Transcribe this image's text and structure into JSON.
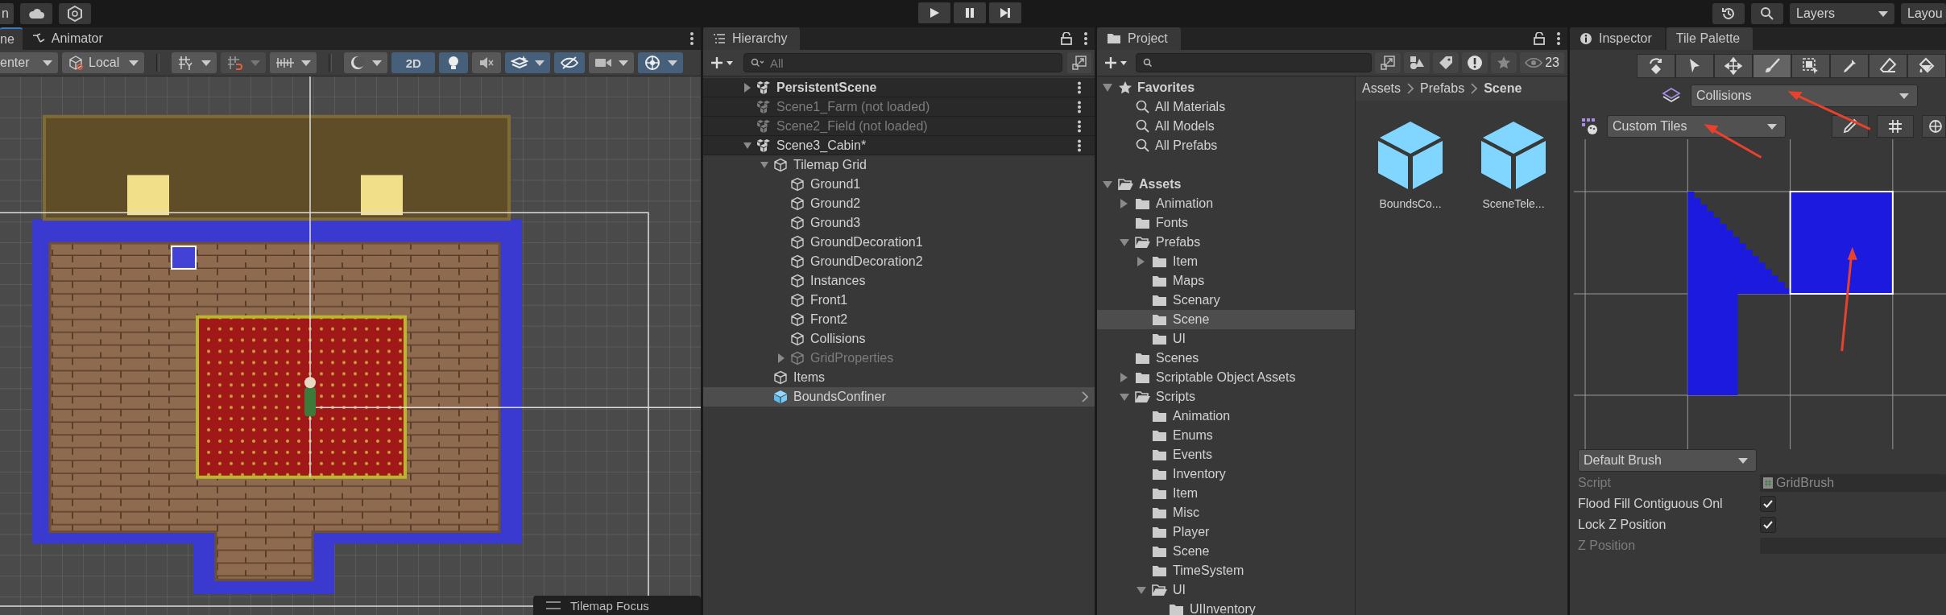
{
  "top_bar": {
    "account_label": "n",
    "play_controls": [
      {
        "kind": "play"
      },
      {
        "kind": "pause"
      },
      {
        "kind": "step"
      }
    ],
    "layers": "Layers",
    "layout": "Layou"
  },
  "scene_panel": {
    "tabs": [
      {
        "label": "ne",
        "kind": "scene",
        "selected": true
      },
      {
        "label": "Animator",
        "kind": "animator",
        "selected": false
      }
    ],
    "pivot": "enter",
    "space": "Local",
    "view_2d": {
      "label": "2D",
      "on": true
    },
    "toggles": [
      {
        "kind": "lighting",
        "on": true
      },
      {
        "kind": "audio",
        "on": false
      },
      {
        "kind": "effects",
        "on": true
      },
      {
        "kind": "visibility",
        "on": true
      },
      {
        "kind": "camera",
        "on": false
      },
      {
        "kind": "gizmos",
        "on": true
      }
    ],
    "overlay": "Tilemap Focus"
  },
  "hierarchy": {
    "title": "Hierarchy",
    "search_placeholder": "All",
    "scenes": [
      {
        "name": "PersistentScene",
        "active": true,
        "loaded": true,
        "expanded": false
      },
      {
        "name": "Scene1_Farm (not loaded)",
        "active": false,
        "loaded": false
      },
      {
        "name": "Scene2_Field (not loaded)",
        "active": false,
        "loaded": false
      },
      {
        "name": "Scene3_Cabin*",
        "active": false,
        "loaded": true,
        "expanded": true,
        "children": [
          {
            "name": "Tilemap Grid",
            "kind": "object",
            "selected": false,
            "disabled": false,
            "expanded": true,
            "children": [
              {
                "name": "Ground1",
                "kind": "object",
                "selected": false,
                "disabled": false
              },
              {
                "name": "Ground2",
                "kind": "object",
                "selected": false,
                "disabled": false
              },
              {
                "name": "Ground3",
                "kind": "object",
                "selected": false,
                "disabled": false
              },
              {
                "name": "GroundDecoration1",
                "kind": "object",
                "selected": false,
                "disabled": false
              },
              {
                "name": "GroundDecoration2",
                "kind": "object",
                "selected": false,
                "disabled": false
              },
              {
                "name": "Instances",
                "kind": "object",
                "selected": false,
                "disabled": false
              },
              {
                "name": "Front1",
                "kind": "object",
                "selected": false,
                "disabled": false
              },
              {
                "name": "Front2",
                "kind": "object",
                "selected": false,
                "disabled": false
              },
              {
                "name": "Collisions",
                "kind": "object",
                "selected": false,
                "disabled": false
              },
              {
                "name": "GridProperties",
                "kind": "object",
                "selected": false,
                "disabled": true,
                "expanded": false
              }
            ]
          },
          {
            "name": "Items",
            "kind": "object",
            "selected": false,
            "disabled": false
          },
          {
            "name": "BoundsConfiner",
            "kind": "prefab",
            "selected": true,
            "disabled": false
          }
        ]
      }
    ]
  },
  "project": {
    "title": "Project",
    "hidden_count": "23",
    "favorites": {
      "label": "Favorites",
      "expanded": true,
      "items": [
        {
          "name": "All Materials",
          "selected": false
        },
        {
          "name": "All Models",
          "selected": false
        },
        {
          "name": "All Prefabs",
          "selected": false
        }
      ]
    },
    "tree": [
      {
        "name": "Assets",
        "selected": false,
        "expanded": true,
        "children": [
          {
            "name": "Animation",
            "selected": false,
            "expanded": false
          },
          {
            "name": "Fonts",
            "selected": false
          },
          {
            "name": "Prefabs",
            "selected": false,
            "expanded": true,
            "children": [
              {
                "name": "Item",
                "selected": false,
                "expanded": false
              },
              {
                "name": "Maps",
                "selected": false
              },
              {
                "name": "Scenary",
                "selected": false
              },
              {
                "name": "Scene",
                "selected": true
              },
              {
                "name": "UI",
                "selected": false
              }
            ]
          },
          {
            "name": "Scenes",
            "selected": false
          },
          {
            "name": "Scriptable Object Assets",
            "selected": false,
            "expanded": false
          },
          {
            "name": "Scripts",
            "selected": false,
            "expanded": true,
            "children": [
              {
                "name": "Animation",
                "selected": false
              },
              {
                "name": "Enums",
                "selected": false
              },
              {
                "name": "Events",
                "selected": false
              },
              {
                "name": "Inventory",
                "selected": false
              },
              {
                "name": "Item",
                "selected": false
              },
              {
                "name": "Misc",
                "selected": false
              },
              {
                "name": "Player",
                "selected": false
              },
              {
                "name": "Scene",
                "selected": false
              },
              {
                "name": "TimeSystem",
                "selected": false
              },
              {
                "name": "UI",
                "selected": false,
                "expanded": true,
                "children": [
                  {
                    "name": "UIInventory",
                    "selected": false
                  }
                ]
              }
            ]
          }
        ]
      }
    ],
    "breadcrumb": [
      "Assets",
      "Prefabs",
      "Scene"
    ],
    "assets": [
      {
        "name": "BoundsCo..."
      },
      {
        "name": "SceneTele..."
      }
    ]
  },
  "inspector": {
    "tabs": [
      {
        "label": "Inspector",
        "kind": "inspector",
        "selected": false
      },
      {
        "label": "Tile Palette",
        "kind": "palette",
        "selected": true
      }
    ],
    "tools": [
      {
        "kind": "rotate",
        "selected": false
      },
      {
        "kind": "select",
        "selected": false
      },
      {
        "kind": "move",
        "selected": false
      },
      {
        "kind": "paint",
        "selected": true
      },
      {
        "kind": "box",
        "selected": false
      },
      {
        "kind": "picker",
        "selected": false
      },
      {
        "kind": "erase",
        "selected": false
      },
      {
        "kind": "fill",
        "selected": false
      }
    ],
    "target": "Collisions",
    "palette": "Custom Tiles",
    "brush": "Default Brush",
    "properties": [
      {
        "label": "Script",
        "kind": "object",
        "value": "GridBrush",
        "disabled": true
      },
      {
        "label": "Flood Fill Contiguous Onl",
        "kind": "toggle",
        "checked": true,
        "disabled": false
      },
      {
        "label": "Lock Z Position",
        "kind": "toggle",
        "checked": true,
        "disabled": false
      },
      {
        "label": "Z Position",
        "kind": "number",
        "disabled": true
      }
    ]
  }
}
